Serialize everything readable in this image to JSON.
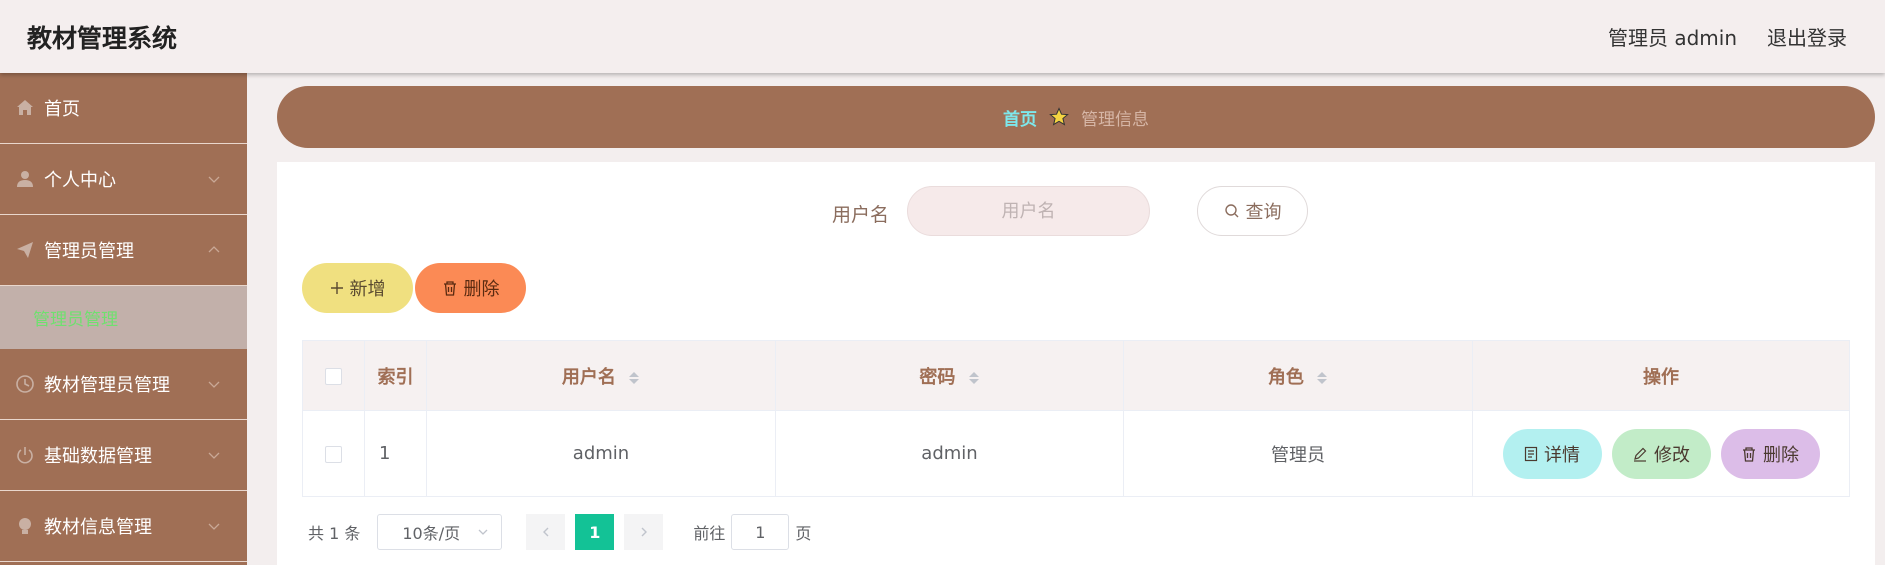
{
  "header": {
    "title": "教材管理系统",
    "user": "管理员 admin",
    "logout": "退出登录"
  },
  "sidebar": {
    "items": [
      {
        "label": "首页",
        "icon": "home-icon"
      },
      {
        "label": "个人中心",
        "icon": "user-icon"
      },
      {
        "label": "管理员管理",
        "icon": "send-icon"
      },
      {
        "label": "教材管理员管理",
        "icon": "clock-icon"
      },
      {
        "label": "基础数据管理",
        "icon": "power-icon"
      },
      {
        "label": "教材信息管理",
        "icon": "bulb-icon"
      }
    ],
    "submenu": {
      "label": "管理员管理"
    }
  },
  "breadcrumb": {
    "home": "首页",
    "current": "管理信息",
    "separator_icon": "star-icon"
  },
  "search": {
    "label": "用户名",
    "placeholder": "用户名",
    "button": "查询"
  },
  "actions": {
    "add": "新增",
    "delete": "删除"
  },
  "table": {
    "headers": {
      "index": "索引",
      "username": "用户名",
      "password": "密码",
      "role": "角色",
      "operation": "操作"
    },
    "rows": [
      {
        "index": "1",
        "username": "admin",
        "password": "admin",
        "role": "管理员"
      }
    ],
    "ops": {
      "detail": "详情",
      "edit": "修改",
      "remove": "删除"
    }
  },
  "pagination": {
    "total": "共 1 条",
    "page_size": "10条/页",
    "current_page": "1",
    "goto_label": "前往",
    "goto_value": "1",
    "page_suffix": "页"
  },
  "colors": {
    "brand": "#a06f55",
    "active_page": "#13c296",
    "breadcrumb_home": "#7de8ec"
  }
}
